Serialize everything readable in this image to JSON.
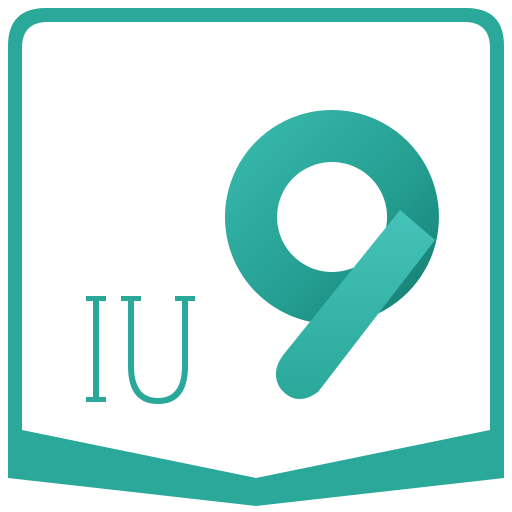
{
  "app_icon": {
    "logo_text": "IU 9",
    "colors": {
      "teal_primary": "#2aa89a",
      "teal_light": "#3bbcb0",
      "teal_dark": "#14786f",
      "frame": "#2aa89a",
      "background": "#ffffff"
    }
  }
}
